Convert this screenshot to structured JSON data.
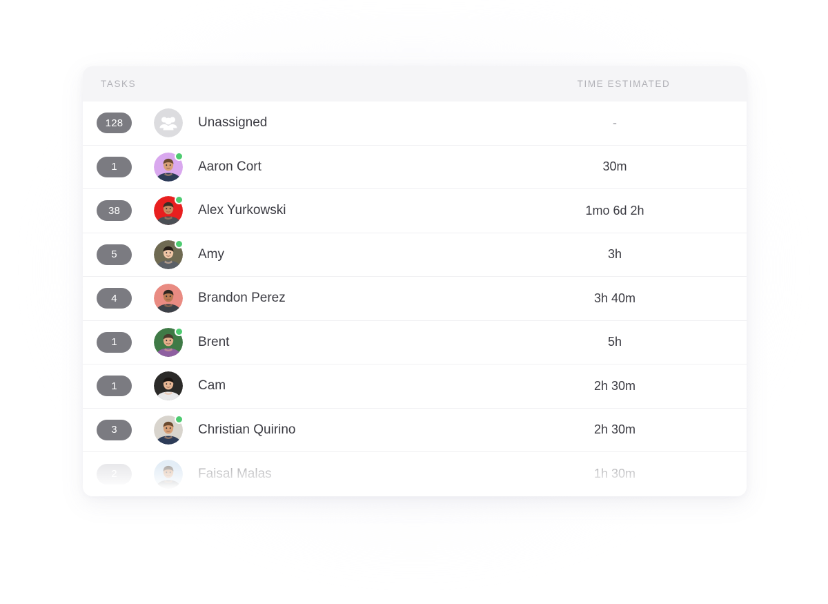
{
  "header": {
    "tasks_label": "TASKS",
    "time_label": "TIME ESTIMATED"
  },
  "colors": {
    "badge": "#7b7b81",
    "badge_muted": "#c9c9cf",
    "status_online": "#4ecb71",
    "header_bg": "#f5f5f7",
    "text": "#3b3b42",
    "muted_text": "#b0b0b6"
  },
  "rows": [
    {
      "count": "128",
      "name": "Unassigned",
      "time": "-",
      "online": false,
      "faded": false,
      "avatar_kind": "group-icon",
      "avatar_bg": "#dcdcdf",
      "badge_style": "dark"
    },
    {
      "count": "1",
      "name": "Aaron Cort",
      "time": "30m",
      "online": true,
      "faded": false,
      "avatar_kind": "photo",
      "avatar_bg": "#d9a8ee",
      "badge_style": "dark"
    },
    {
      "count": "38",
      "name": "Alex Yurkowski",
      "time": "1mo 6d 2h",
      "online": true,
      "faded": false,
      "avatar_kind": "photo",
      "avatar_bg": "#e81f1f",
      "badge_style": "dark"
    },
    {
      "count": "5",
      "name": "Amy",
      "time": "3h",
      "online": true,
      "faded": false,
      "avatar_kind": "photo",
      "avatar_bg": "#6f6a52",
      "badge_style": "dark"
    },
    {
      "count": "4",
      "name": "Brandon Perez",
      "time": "3h 40m",
      "online": false,
      "faded": false,
      "avatar_kind": "photo",
      "avatar_bg": "#e98b82",
      "badge_style": "dark"
    },
    {
      "count": "1",
      "name": "Brent",
      "time": "5h",
      "online": true,
      "faded": false,
      "avatar_kind": "photo",
      "avatar_bg": "#3f7a46",
      "badge_style": "dark"
    },
    {
      "count": "1",
      "name": "Cam",
      "time": "2h 30m",
      "online": false,
      "faded": false,
      "avatar_kind": "photo",
      "avatar_bg": "#2b2a28",
      "badge_style": "dark"
    },
    {
      "count": "3",
      "name": "Christian Quirino",
      "time": "2h 30m",
      "online": true,
      "faded": false,
      "avatar_kind": "photo",
      "avatar_bg": "#d8d4cd",
      "badge_style": "dark"
    },
    {
      "count": "2",
      "name": "Faisal Malas",
      "time": "1h 30m",
      "online": false,
      "faded": true,
      "avatar_kind": "photo",
      "avatar_bg": "#bcd4ea",
      "badge_style": "muted"
    }
  ]
}
